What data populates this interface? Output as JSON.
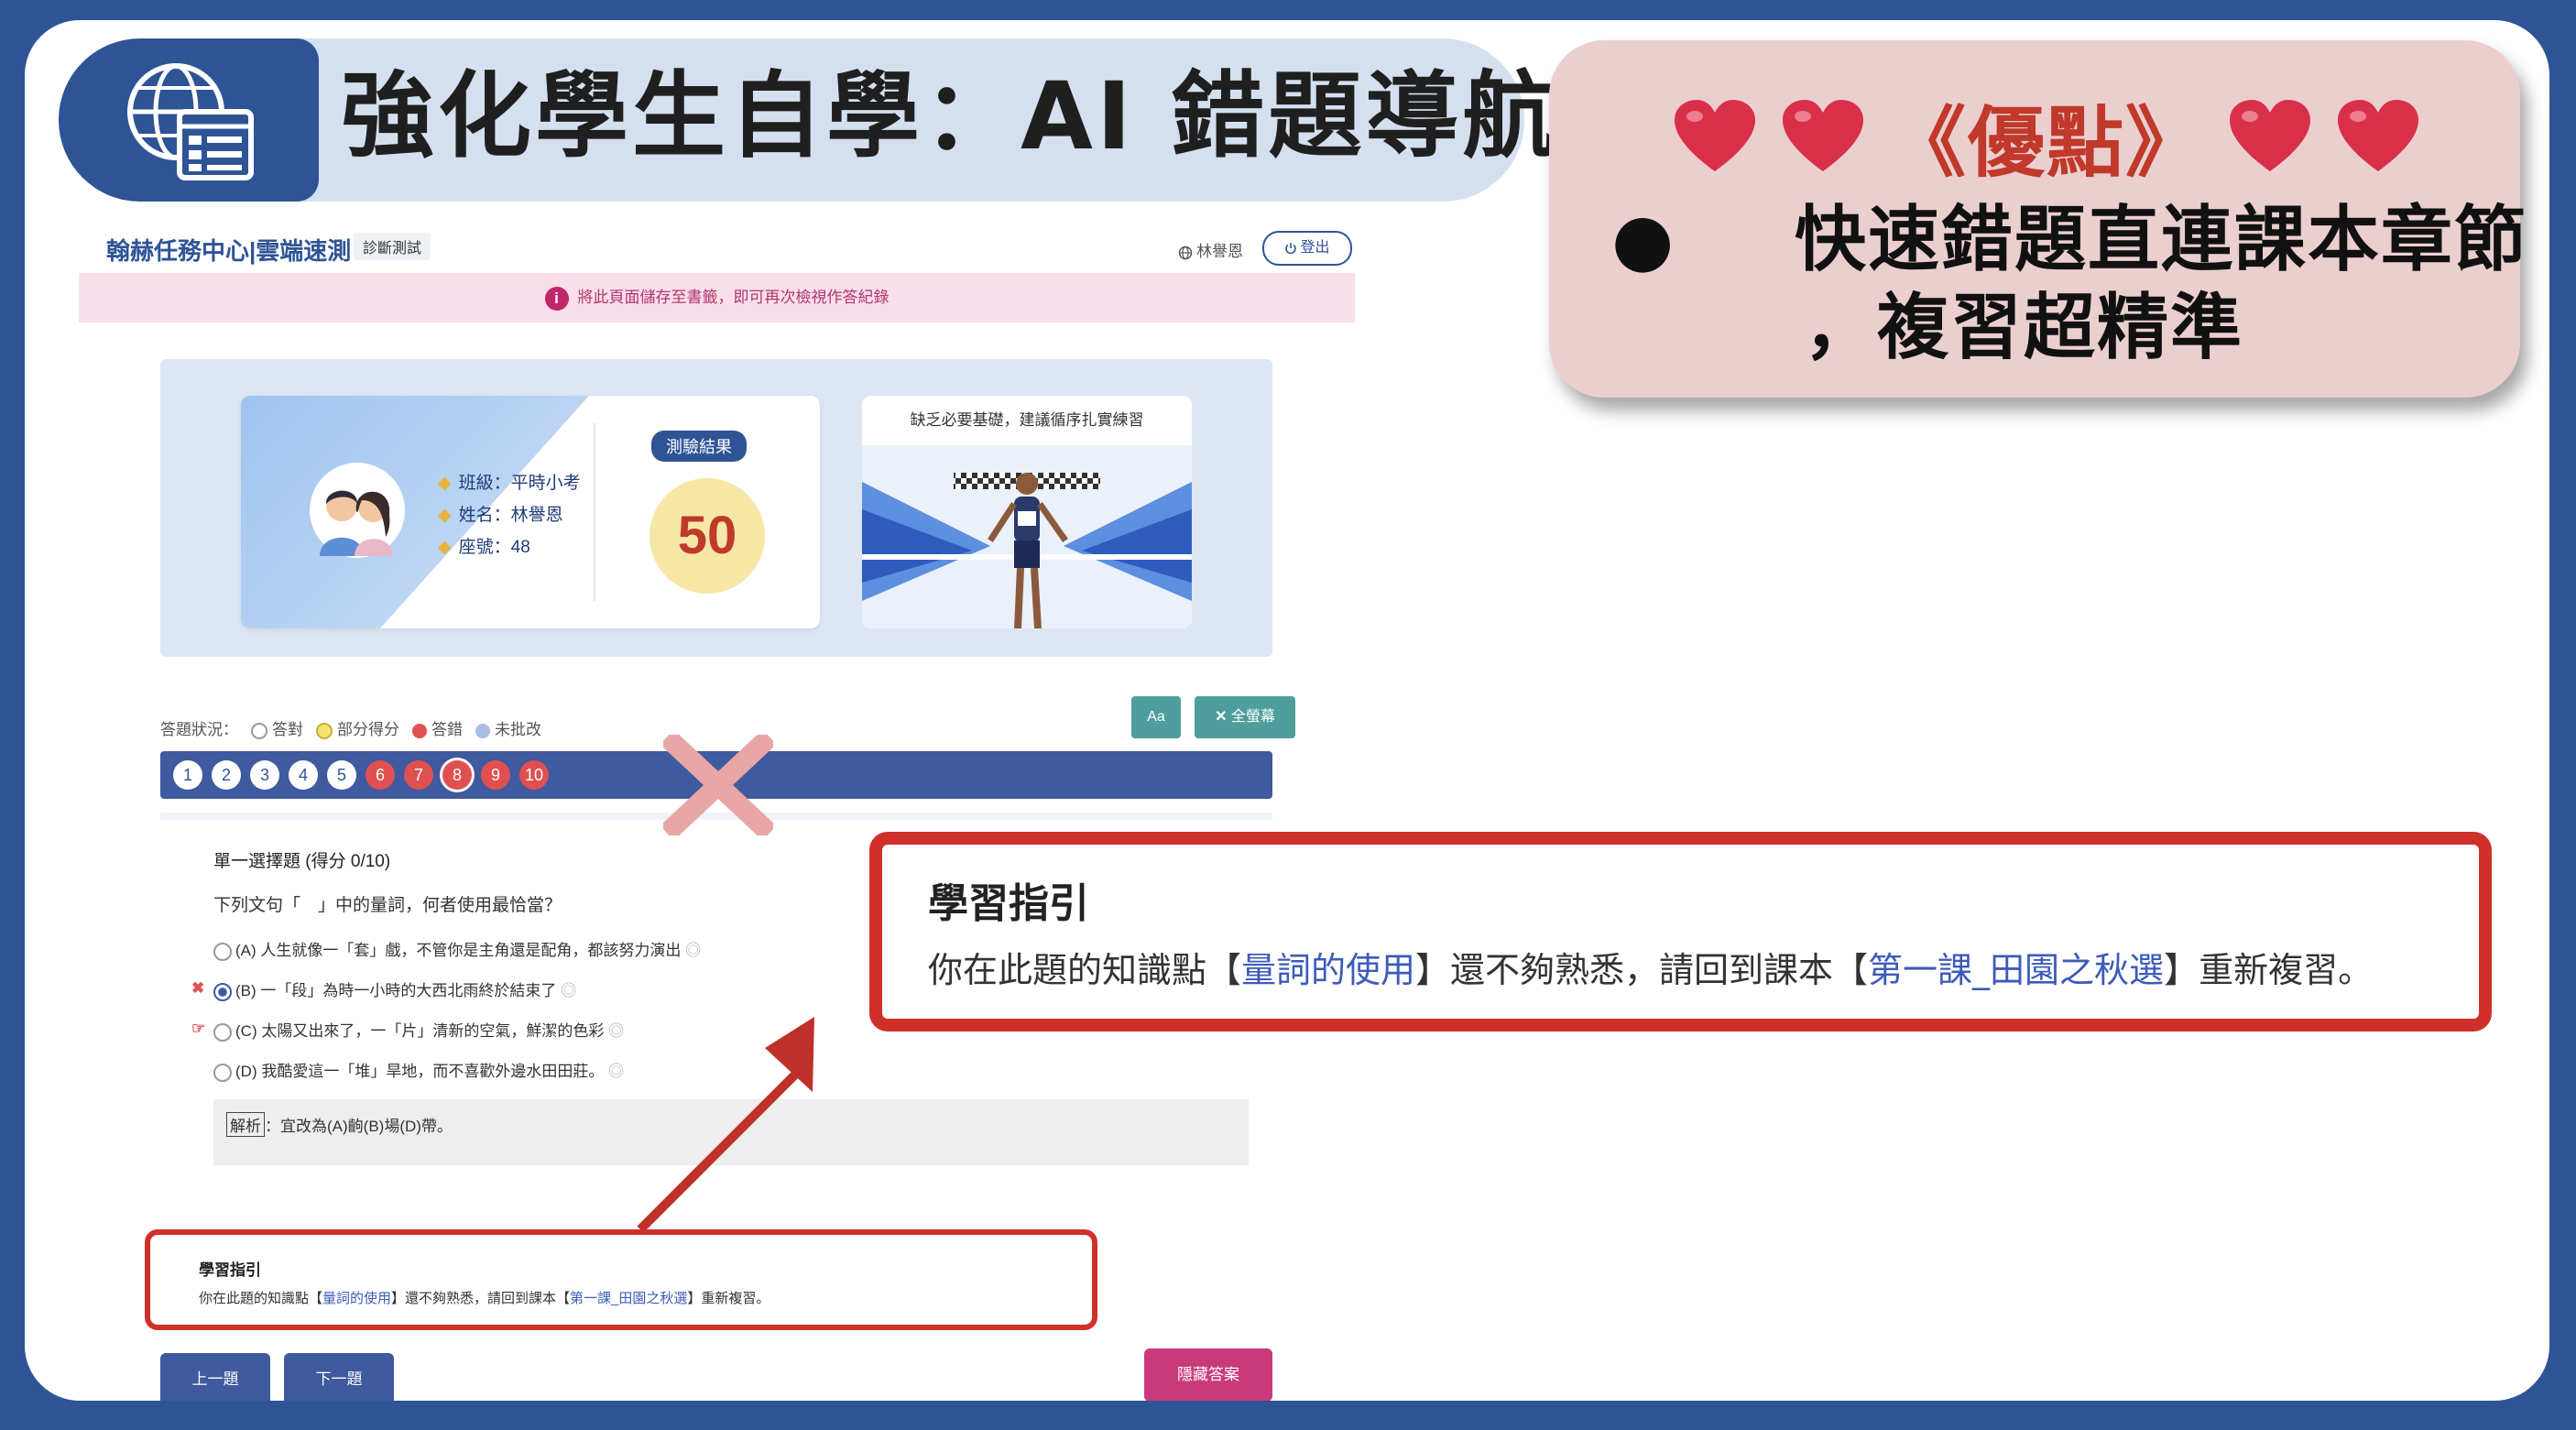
{
  "slide": {
    "title": "強化學生自學：AI 錯題導航",
    "advantage": {
      "heading": "《優點》",
      "bullet": "●",
      "line1": "快速錯題直連課本章節",
      "line2": "，複習超精準"
    }
  },
  "app": {
    "brand": "翰赫任務中心|雲端速測",
    "mode_tag": "診斷測試",
    "user": "林譽恩",
    "logout_label": "登出",
    "notice_icon": "i",
    "notice": "將此頁面儲存至書籤，即可再次檢視作答紀錄",
    "student": {
      "class": "班級：平時小考",
      "name": "姓名：林譽恩",
      "seat": "座號：48"
    },
    "result_label": "測驗結果",
    "score": "50",
    "advice": "缺乏必要基礎，建議循序扎實練習",
    "status": {
      "prefix": "答題狀況：",
      "correct": "答對",
      "partial": "部分得分",
      "wrong": "答錯",
      "ungraded": "未批改"
    },
    "font_button": "Aa",
    "fullscreen_button": "全螢幕",
    "questions": [
      "1",
      "2",
      "3",
      "4",
      "5",
      "6",
      "7",
      "8",
      "9",
      "10"
    ],
    "question_states": [
      "ok",
      "ok",
      "ok",
      "ok",
      "ok",
      "bad",
      "bad",
      "bad",
      "bad",
      "bad"
    ],
    "current_question": "8",
    "question": {
      "title": "單一選擇題 (得分 0/10)",
      "stem": "下列文句「　」中的量詞，何者使用最恰當？",
      "options": [
        "(A) 人生就像一「套」戲，不管你是主角還是配角，都該努力演出",
        "(B) 一「段」為時一小時的大西北雨終於結束了",
        "(C) 太陽又出來了，一「片」清新的空氣，鮮潔的色彩",
        "(D) 我酷愛這一「堆」旱地，而不喜歡外邊水田田莊。"
      ],
      "explain_tag": "解析",
      "explain": "：宜改為(A)齣(B)場(D)帶。"
    },
    "guide": {
      "title": "學習指引",
      "pre": "你在此題的知識點【",
      "concept": "量詞的使用",
      "mid": "】還不夠熟悉，請回到課本【",
      "chapter": "第一課_田園之秋選",
      "post": "】重新複習。"
    },
    "prev_button": "上一題",
    "next_button": "下一題",
    "hide_answer_button": "隱藏答案"
  },
  "colors": {
    "frame": "#2f5496",
    "banner": "#d4e0ef",
    "advantage_bg": "#ebcfcf",
    "advantage_heading": "#c0392b",
    "highlight_box": "#d0302a",
    "wrong": "#e05050",
    "link": "#3d5bb8"
  }
}
